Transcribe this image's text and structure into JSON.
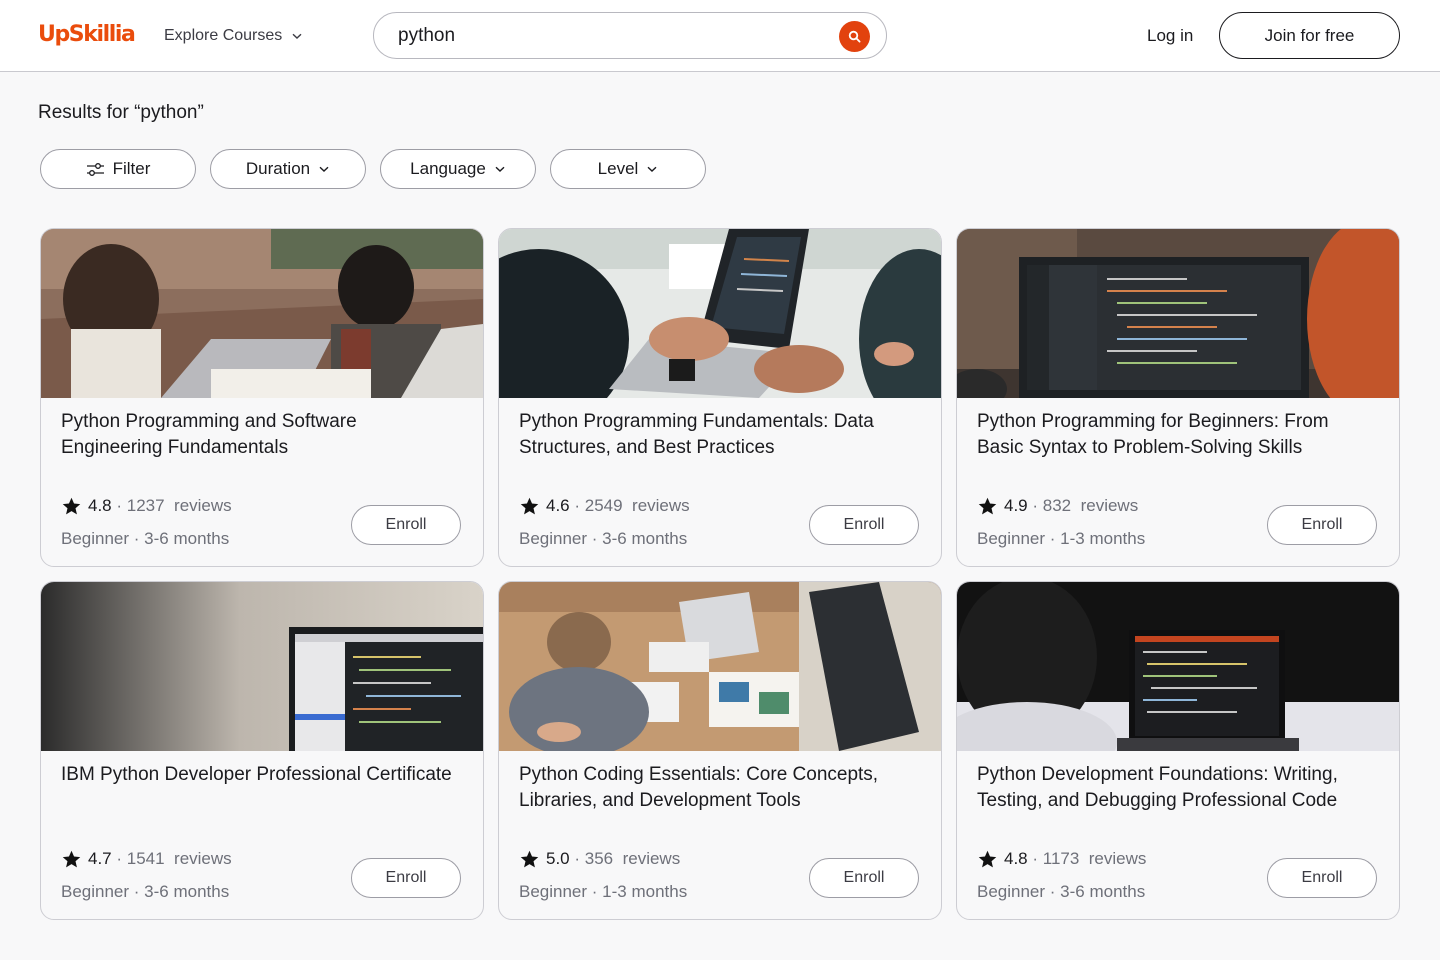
{
  "header": {
    "logo": "UpSkillia",
    "explore_label": "Explore Courses",
    "search_value": "python",
    "login_label": "Log in",
    "join_label": "Join for free"
  },
  "results_heading": "Results for “python”",
  "filters": {
    "filter_label": "Filter",
    "duration_label": "Duration",
    "language_label": "Language",
    "level_label": "Level"
  },
  "courses": [
    {
      "title": "Python Programming and Software Engineering Fundamentals",
      "rating": "4.8",
      "reviews": "1237",
      "reviews_word": "reviews",
      "level": "Beginner",
      "duration": "3-6 months",
      "enroll_label": "Enroll"
    },
    {
      "title": "Python Programming Fundamentals: Data Structures, and Best Practices",
      "rating": "4.6",
      "reviews": "2549",
      "reviews_word": "reviews",
      "level": "Beginner",
      "duration": "3-6 months",
      "enroll_label": "Enroll"
    },
    {
      "title": "Python Programming for Beginners: From Basic Syntax to Problem-Solving Skills",
      "rating": "4.9",
      "reviews": "832",
      "reviews_word": "reviews",
      "level": "Beginner",
      "duration": "1-3 months",
      "enroll_label": "Enroll"
    },
    {
      "title": "IBM Python Developer Professional Certificate",
      "rating": "4.7",
      "reviews": "1541",
      "reviews_word": "reviews",
      "level": "Beginner",
      "duration": "3-6 months",
      "enroll_label": "Enroll"
    },
    {
      "title": "Python Coding Essentials: Core Concepts, Libraries, and Development Tools",
      "rating": "5.0",
      "reviews": "356",
      "reviews_word": "reviews",
      "level": "Beginner",
      "duration": "1-3 months",
      "enroll_label": "Enroll"
    },
    {
      "title": "Python Development Foundations: Writing, Testing, and Debugging Professional Code",
      "rating": "4.8",
      "reviews": "1173",
      "reviews_word": "reviews",
      "level": "Beginner",
      "duration": "3-6 months",
      "enroll_label": "Enroll"
    }
  ],
  "colors": {
    "brand": "#ea4c0c",
    "search_button": "#e2420e",
    "muted_text": "#6e7079",
    "border": "#cdcdd3"
  },
  "icons": {
    "search_button": "search-icon",
    "explore_dropdown": "chevron-down-icon",
    "filter": "sliders-icon",
    "rating": "star-icon"
  }
}
